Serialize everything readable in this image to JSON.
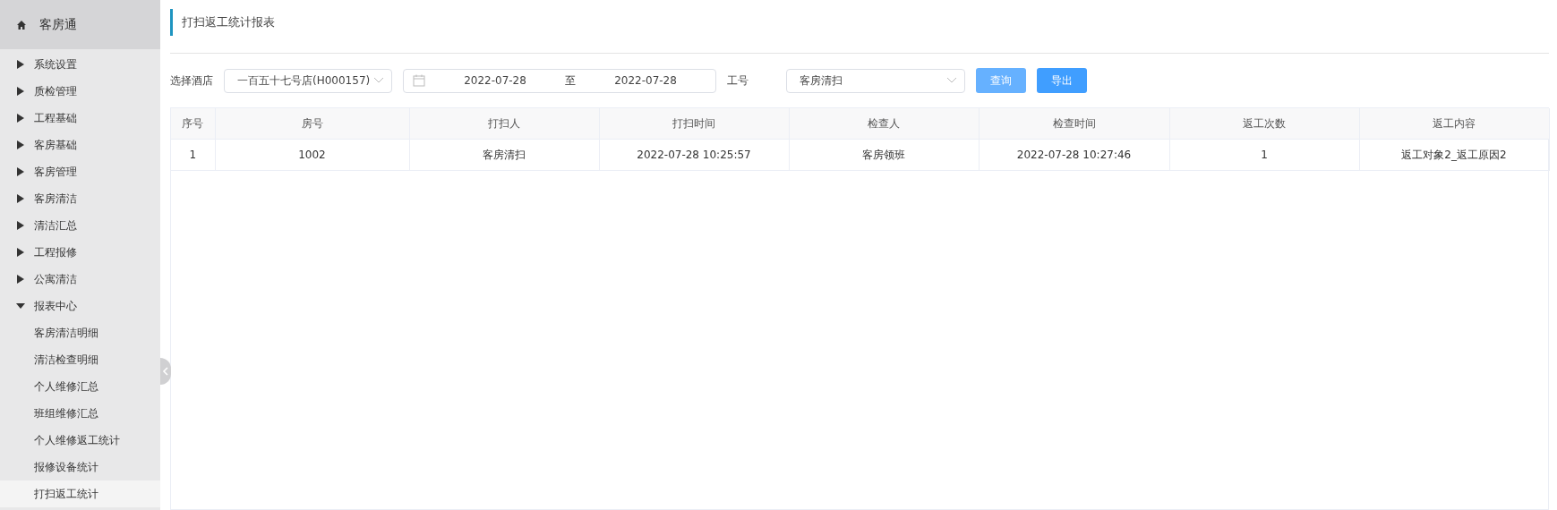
{
  "sidebar": {
    "title": "客房通",
    "items": [
      {
        "label": "系统设置",
        "expanded": false
      },
      {
        "label": "质检管理",
        "expanded": false
      },
      {
        "label": "工程基础",
        "expanded": false
      },
      {
        "label": "客房基础",
        "expanded": false
      },
      {
        "label": "客房管理",
        "expanded": false
      },
      {
        "label": "客房清洁",
        "expanded": false
      },
      {
        "label": "清洁汇总",
        "expanded": false
      },
      {
        "label": "工程报修",
        "expanded": false
      },
      {
        "label": "公寓清洁",
        "expanded": false
      },
      {
        "label": "报表中心",
        "expanded": true,
        "children": [
          {
            "label": "客房清洁明细",
            "selected": false
          },
          {
            "label": "清洁检查明细",
            "selected": false
          },
          {
            "label": "个人维修汇总",
            "selected": false
          },
          {
            "label": "班组维修汇总",
            "selected": false
          },
          {
            "label": "个人维修返工统计",
            "selected": false
          },
          {
            "label": "报修设备统计",
            "selected": false
          },
          {
            "label": "打扫返工统计",
            "selected": true
          }
        ]
      }
    ]
  },
  "page_title": "打扫返工统计报表",
  "filters": {
    "hotel_label": "选择酒店",
    "hotel_value": "一百五十七号店(H000157)",
    "date_from": "2022-07-28",
    "date_sep": "至",
    "date_to": "2022-07-28",
    "staff_label": "工号",
    "staff_value": "客房清扫"
  },
  "buttons": [
    {
      "label": "查询",
      "kind": "light"
    },
    {
      "label": "导出",
      "kind": "primary"
    }
  ],
  "table": {
    "columns": [
      "序号",
      "房号",
      "打扫人",
      "打扫时间",
      "检查人",
      "检查时间",
      "返工次数",
      "返工内容"
    ],
    "rows": [
      [
        "1",
        "1002",
        "客房清扫",
        "2022-07-28 10:25:57",
        "客房领班",
        "2022-07-28 10:27:46",
        "1",
        "返工对象2_返工原因2"
      ]
    ]
  }
}
